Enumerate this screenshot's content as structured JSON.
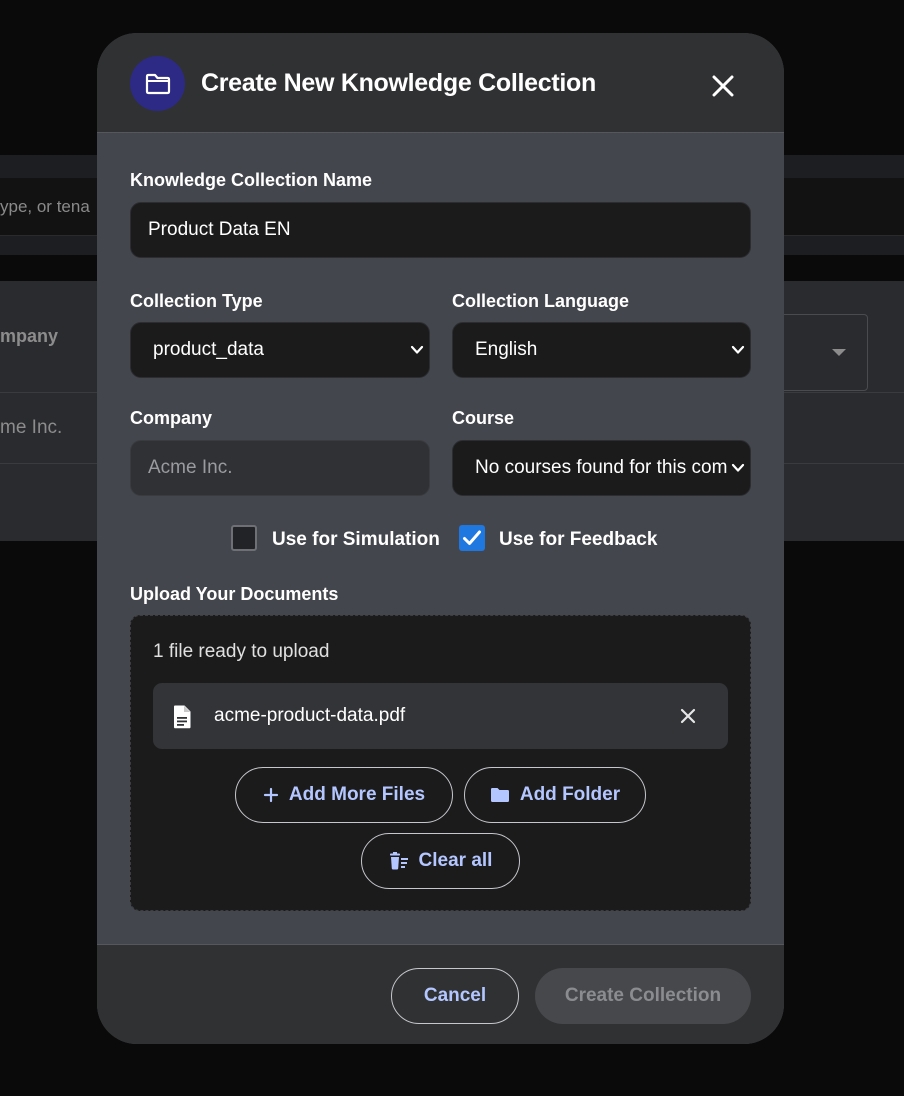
{
  "background": {
    "search_text": "ype, or tena",
    "column_header": "mpany",
    "cell_value": "me Inc."
  },
  "modal": {
    "title": "Create New Knowledge Collection",
    "name_label": "Knowledge Collection Name",
    "name_value": "Product Data EN",
    "type_label": "Collection Type",
    "type_value": "product_data",
    "language_label": "Collection Language",
    "language_value": "English",
    "company_label": "Company",
    "company_placeholder": "Acme Inc.",
    "course_label": "Course",
    "course_value": "No courses found for this company",
    "simulation_label": "Use for Simulation",
    "simulation_checked": false,
    "feedback_label": "Use for Feedback",
    "feedback_checked": true,
    "upload_label": "Upload Your Documents",
    "upload_status": "1 file ready to upload",
    "files": [
      {
        "name": "acme-product-data.pdf",
        "icon": "document-icon"
      }
    ],
    "add_files_label": "Add More Files",
    "add_folder_label": "Add Folder",
    "clear_all_label": "Clear all",
    "cancel_label": "Cancel",
    "create_label": "Create Collection"
  },
  "colors": {
    "accent": "#1f77e0",
    "header_icon_bg": "#2d2a85",
    "button_text": "#b3c6ff"
  }
}
